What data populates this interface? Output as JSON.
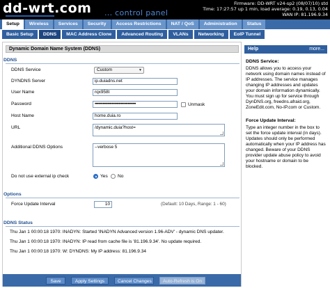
{
  "header": {
    "logo": "dd-wrt.com",
    "subtitle": "... control panel",
    "firmware": "Firmware: DD-WRT v24-sp2 (08/07/10) std",
    "time": "Time: 17:27:57 up 1 min, load average: 0.19, 0.13, 0.04",
    "wan_ip": "WAN IP: 81.196.9.34"
  },
  "main_tabs": [
    "Setup",
    "Wireless",
    "Services",
    "Security",
    "Access Restrictions",
    "NAT / QoS",
    "Administration",
    "Status"
  ],
  "sub_tabs": [
    "Basic Setup",
    "DDNS",
    "MAC Address Clone",
    "Advanced Routing",
    "VLANs",
    "Networking",
    "EoIP Tunnel"
  ],
  "page_title": "Dynamic Domain Name System (DDNS)",
  "ddns": {
    "legend": "DDNS",
    "service_label": "DDNS Service",
    "service_value": "Custom",
    "server_label": "DYNDNS Server",
    "server_value": "ip.duiadns.net",
    "username_label": "User Name",
    "username_value": "rqx958t",
    "password_label": "Password",
    "password_value": "••••••••••••••••••••••••••••••••••••",
    "unmask_label": "Unmask",
    "hostname_label": "Host Name",
    "hostname_value": "home.duia.ro",
    "url_label": "URL",
    "url_value": "/dynamic.duia?host=",
    "options_label": "Additional DDNS Options",
    "options_value": "--verbose 5",
    "external_ip_label": "Do not use external ip check",
    "yes_label": "Yes",
    "no_label": "No"
  },
  "options": {
    "legend": "Options",
    "interval_label": "Force Update Interval",
    "interval_value": "10",
    "interval_hint": "(Default: 10 Days, Range: 1 - 60)"
  },
  "status": {
    "legend": "DDNS Status",
    "lines": [
      "Thu Jan 1 00:00:18 1970: INADYN: Started 'INADYN Advanced version 1.96-ADV' - dynamic DNS updater.",
      "Thu Jan 1 00:00:18 1970: INADYN: IP read from cache file is '81.196.9.34'. No update required.",
      "Thu Jan 1 00:00:18 1970: W: DYNDNS: My IP address: 81.196.9.34"
    ]
  },
  "buttons": {
    "save": "Save",
    "apply": "Apply Settings",
    "cancel": "Cancel Changes",
    "autorefresh": "Auto-Refresh is On"
  },
  "help": {
    "header": "Help",
    "more": "more...",
    "ddns_title": "DDNS Service:",
    "ddns_body": "DDNS allows you to access your network using domain names instead of IP addresses. The service manages changing IP addresses and updates your domain information dynamically. You must sign up for service through DynDNS.org, freedns.afraid.org, ZoneEdit.com, No-IP.com or Custom.",
    "force_title": "Force Update Interval:",
    "force_body": "Type an integer number in the box to set the force update interval (in days). Updates should only be performed automatically when your IP address has changed. Beware of your DDNS provider update abuse policy to avoid your hostname or domain to be blocked."
  },
  "colors": {
    "header_bg": "#000000",
    "tab_bar": "#3a6aa8",
    "subtab": "#2f5f9e",
    "accent_text": "#1f4f8f"
  }
}
